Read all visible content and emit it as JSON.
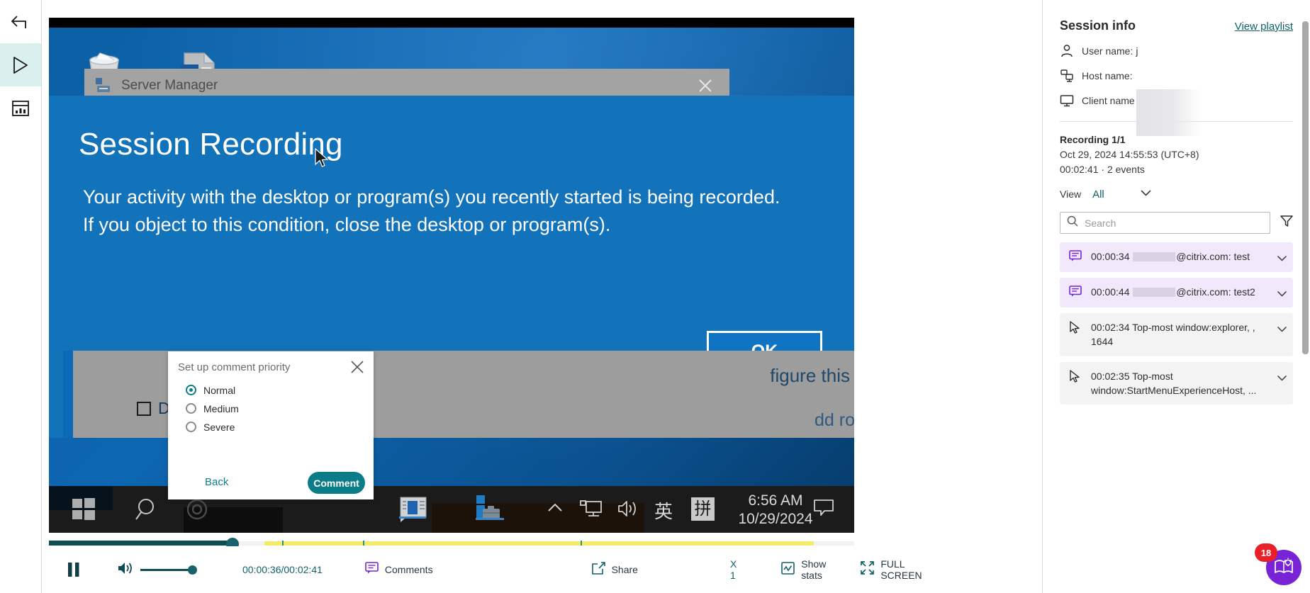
{
  "rail": {
    "items": [
      {
        "name": "back",
        "icon": "back-arrow-icon",
        "active": false
      },
      {
        "name": "play",
        "icon": "play-icon",
        "active": true
      },
      {
        "name": "dashboard",
        "icon": "dashboard-chart-icon",
        "active": false
      }
    ]
  },
  "video": {
    "server_manager_title": "Server Manager",
    "notice_title": "Session Recording",
    "notice_body": "Your activity with the desktop or program(s) you recently started is being recorded. If you object to this condition, close the desktop or program(s).",
    "ok_label": "OK",
    "dont_show_label": "Don",
    "right_clipped_text": "figure this",
    "faint_text": "dd roles an",
    "taskbar": {
      "ime_label": "英",
      "ime_pin_label": "拼",
      "clock_time": "6:56 AM",
      "clock_date": "10/29/2024"
    }
  },
  "dialog": {
    "title": "Set up comment priority",
    "options": [
      {
        "label": "Normal",
        "selected": true
      },
      {
        "label": "Medium",
        "selected": false
      },
      {
        "label": "Severe",
        "selected": false
      }
    ],
    "back_label": "Back",
    "comment_label": "Comment"
  },
  "timeline": {
    "played_percent": 22.4,
    "yellow_start_percent": 26.8,
    "yellow_end_percent": 95.0,
    "knob_percent": 22.8,
    "markers_percent": [
      29.0,
      39.0,
      66.0
    ]
  },
  "controls": {
    "pause_label": "pause",
    "volume_percent": 100,
    "time_current": "00:00:36",
    "time_total": "00:02:41",
    "time_display": "00:00:36/00:02:41",
    "comments_label": "Comments",
    "share_label": "Share",
    "speed_label": "X 1",
    "stats_label": "Show stats",
    "fullscreen_label": "FULL SCREEN"
  },
  "session_info": {
    "heading": "Session info",
    "view_playlist_label": "View playlist",
    "rows": [
      {
        "icon": "user-icon",
        "label": "User name:",
        "value": "j"
      },
      {
        "icon": "host-icon",
        "label": "Host name:",
        "value": ""
      },
      {
        "icon": "monitor-icon",
        "label": "Client name",
        "value": ""
      }
    ],
    "recording_title": "Recording 1/1",
    "recording_date": "Oct 29, 2024 14:55:53 (UTC+8)",
    "recording_duration": "00:02:41 · 2 events",
    "view_label": "View",
    "view_value": "All"
  },
  "search": {
    "placeholder": "Search",
    "value": ""
  },
  "events": [
    {
      "type": "comment",
      "icon": "comment-icon",
      "time": "00:00:34",
      "redacted": true,
      "text_after": "@citrix.com: test"
    },
    {
      "type": "comment",
      "icon": "comment-icon",
      "time": "00:00:44",
      "redacted": true,
      "text_after": "@citrix.com: test2"
    },
    {
      "type": "window",
      "icon": "cursor-icon",
      "time": "00:02:34",
      "redacted": false,
      "text_after": "Top-most window:explorer, , 1644"
    },
    {
      "type": "window",
      "icon": "cursor-icon",
      "time": "00:02:35",
      "redacted": false,
      "text_after": "Top-most window:StartMenuExperienceHost, ..."
    }
  ],
  "help": {
    "badge_count": "18",
    "icon": "book-idea-icon"
  },
  "colors": {
    "accent_teal": "#11616b",
    "dialog_accent": "#0b7d88",
    "timeline_yellow": "#f5ea6a",
    "comment_row_bg": "#f1e9fb",
    "help_purple": "#7823d6",
    "badge_red": "#e8202a",
    "desktop_blue": "#1273ba"
  }
}
